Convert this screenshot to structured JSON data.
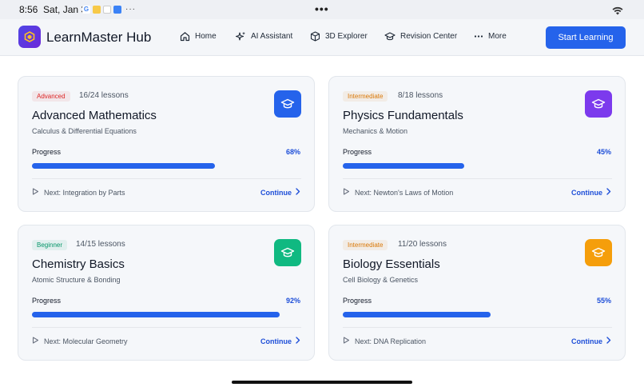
{
  "status_bar": {
    "time": "8:56",
    "date": "Sat, Jan 3",
    "notification_icons": [
      "google-icon",
      "notes-icon",
      "photos-icon",
      "app-icon"
    ],
    "overflow": "···"
  },
  "nav": {
    "brand": "LearnMaster Hub",
    "items": [
      {
        "label": "Home",
        "icon": "home-icon"
      },
      {
        "label": "AI Assistant",
        "icon": "sparkle-icon"
      },
      {
        "label": "3D Explorer",
        "icon": "cube-icon"
      },
      {
        "label": "Revision Center",
        "icon": "graduation-cap-icon"
      },
      {
        "label": "More",
        "icon": "more-dots-icon"
      }
    ],
    "cta": "Start Learning"
  },
  "courses": [
    {
      "level": "Advanced",
      "lessons": "16/24 lessons",
      "title": "Advanced Mathematics",
      "subtitle": "Calculus & Differential Equations",
      "progress_label": "Progress",
      "progress_text": "68%",
      "progress": 0.68,
      "next": "Next: Integration by Parts",
      "continue": "Continue",
      "icon_color": "#2563eb",
      "badge_color": "#dc2626"
    },
    {
      "level": "Intermediate",
      "lessons": "8/18 lessons",
      "title": "Physics Fundamentals",
      "subtitle": "Mechanics & Motion",
      "progress_label": "Progress",
      "progress_text": "45%",
      "progress": 0.45,
      "next": "Next: Newton's Laws of Motion",
      "continue": "Continue",
      "icon_color": "#7c3aed",
      "badge_color": "#d97706"
    },
    {
      "level": "Beginner",
      "lessons": "14/15 lessons",
      "title": "Chemistry Basics",
      "subtitle": "Atomic Structure & Bonding",
      "progress_label": "Progress",
      "progress_text": "92%",
      "progress": 0.92,
      "next": "Next: Molecular Geometry",
      "continue": "Continue",
      "icon_color": "#10b981",
      "badge_color": "#059669"
    },
    {
      "level": "Intermediate",
      "lessons": "11/20 lessons",
      "title": "Biology Essentials",
      "subtitle": "Cell Biology & Genetics",
      "progress_label": "Progress",
      "progress_text": "55%",
      "progress": 0.55,
      "next": "Next: DNA Replication",
      "continue": "Continue",
      "icon_color": "#f59e0b",
      "badge_color": "#d97706"
    }
  ]
}
